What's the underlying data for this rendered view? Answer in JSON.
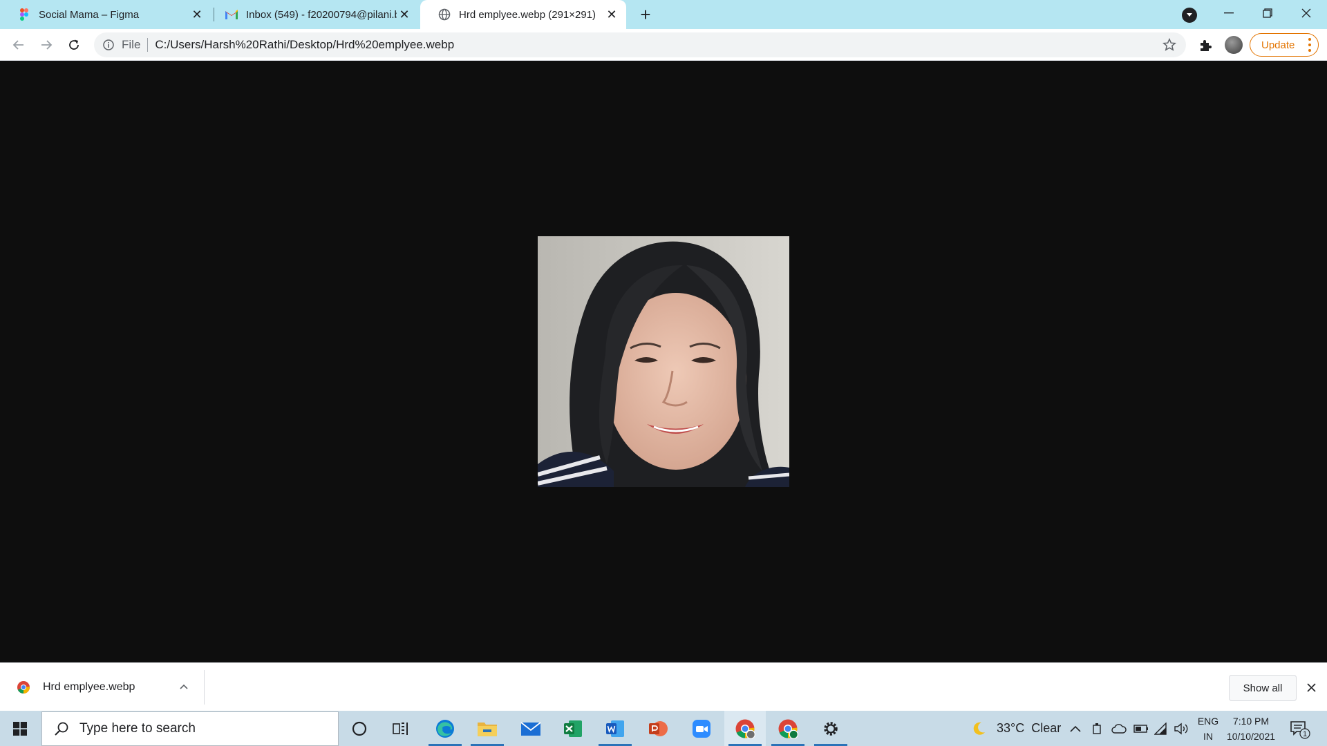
{
  "browser": {
    "tabs": [
      {
        "title": "Social Mama – Figma",
        "icon": "figma-icon",
        "active": false
      },
      {
        "title": "Inbox (549) - f20200794@pilani.b",
        "icon": "gmail-icon",
        "active": false
      },
      {
        "title": "Hrd emplyee.webp (291×291)",
        "icon": "globe-icon",
        "active": true
      }
    ],
    "address": {
      "scheme_label": "File",
      "url": "C:/Users/Harsh%20Rathi/Desktop/Hrd%20emplyee.webp"
    },
    "update_label": "Update",
    "accent_color": "#e37400"
  },
  "viewer": {
    "image_alt": "Hrd emplyee.webp",
    "background_color": "#0e0e0e"
  },
  "download_shelf": {
    "item_name": "Hrd emplyee.webp",
    "show_all_label": "Show all"
  },
  "taskbar": {
    "search_placeholder": "Type here to search",
    "pinned_apps": [
      "cortana-icon",
      "task-view-icon",
      "edge-icon",
      "file-explorer-icon",
      "mail-icon",
      "excel-icon",
      "word-icon",
      "powerpoint-icon",
      "zoom-icon",
      "chrome-icon",
      "chrome-profile-icon",
      "settings-icon"
    ],
    "weather": {
      "temp": "33°C",
      "condition": "Clear",
      "icon": "moon-icon"
    },
    "language": {
      "line1": "ENG",
      "line2": "IN"
    },
    "clock": {
      "time": "7:10 PM",
      "date": "10/10/2021"
    },
    "notifications_count": "1"
  }
}
